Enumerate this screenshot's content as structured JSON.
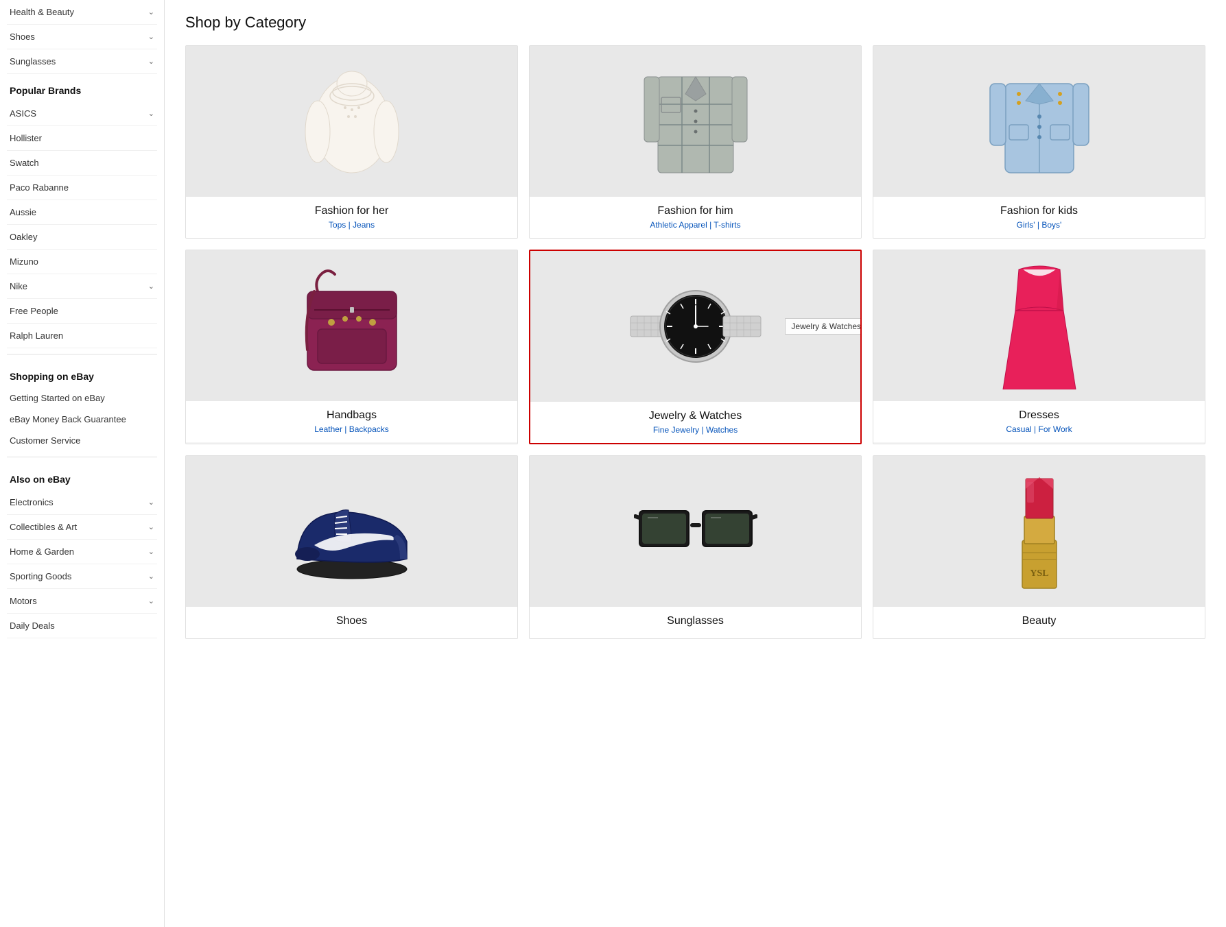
{
  "sidebar": {
    "health_beauty": {
      "label": "Health & Beauty",
      "hasChevron": true
    },
    "shoes": {
      "label": "Shoes",
      "hasChevron": true
    },
    "sunglasses": {
      "label": "Sunglasses",
      "hasChevron": true
    },
    "popular_brands_title": "Popular Brands",
    "brands": [
      {
        "label": "ASICS",
        "hasChevron": true
      },
      {
        "label": "Hollister",
        "hasChevron": false
      },
      {
        "label": "Swatch",
        "hasChevron": false
      },
      {
        "label": "Paco Rabanne",
        "hasChevron": false
      },
      {
        "label": "Aussie",
        "hasChevron": false
      },
      {
        "label": "Oakley",
        "hasChevron": false
      },
      {
        "label": "Mizuno",
        "hasChevron": false
      },
      {
        "label": "Nike",
        "hasChevron": true
      },
      {
        "label": "Free People",
        "hasChevron": false
      },
      {
        "label": "Ralph Lauren",
        "hasChevron": false
      }
    ],
    "shopping_title": "Shopping on eBay",
    "shopping_links": [
      "Getting Started on eBay",
      "eBay Money Back Guarantee",
      "Customer Service"
    ],
    "also_title": "Also on eBay",
    "also_items": [
      {
        "label": "Electronics",
        "hasChevron": true
      },
      {
        "label": "Collectibles & Art",
        "hasChevron": true
      },
      {
        "label": "Home & Garden",
        "hasChevron": true
      },
      {
        "label": "Sporting Goods",
        "hasChevron": true
      },
      {
        "label": "Motors",
        "hasChevron": true
      },
      {
        "label": "Daily Deals",
        "hasChevron": false
      }
    ]
  },
  "main": {
    "title": "Shop by Category",
    "categories": [
      {
        "id": "fashion-her",
        "title": "Fashion for her",
        "subtitle1": "Tops",
        "subtitle2": "Jeans",
        "highlighted": false
      },
      {
        "id": "fashion-him",
        "title": "Fashion for him",
        "subtitle1": "Athletic Apparel",
        "subtitle2": "T-shirts",
        "highlighted": false
      },
      {
        "id": "fashion-kids",
        "title": "Fashion for kids",
        "subtitle1": "Girls'",
        "subtitle2": "Boys'",
        "highlighted": false
      },
      {
        "id": "handbags",
        "title": "Handbags",
        "subtitle1": "Leather",
        "subtitle2": "Backpacks",
        "highlighted": false
      },
      {
        "id": "jewelry-watches",
        "title": "Jewelry & Watches",
        "subtitle1": "Fine Jewelry",
        "subtitle2": "Watches",
        "highlighted": true,
        "tooltip": "Jewelry & Watches"
      },
      {
        "id": "dresses",
        "title": "Dresses",
        "subtitle1": "Casual",
        "subtitle2": "For Work",
        "highlighted": false
      },
      {
        "id": "shoes",
        "title": "Shoes",
        "subtitle1": "",
        "subtitle2": "",
        "highlighted": false
      },
      {
        "id": "sunglasses",
        "title": "Sunglasses",
        "subtitle1": "",
        "subtitle2": "",
        "highlighted": false
      },
      {
        "id": "beauty",
        "title": "Beauty",
        "subtitle1": "",
        "subtitle2": "",
        "highlighted": false
      }
    ]
  }
}
